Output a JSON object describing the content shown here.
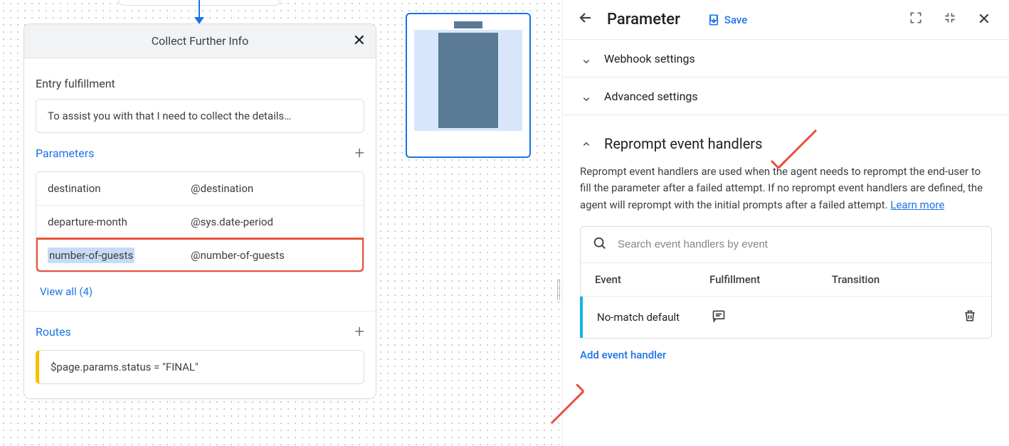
{
  "page_card": {
    "title": "Collect Further Info",
    "entry_label": "Entry fulfillment",
    "entry_text": "To assist you with that I need to collect the details…",
    "params_label": "Parameters",
    "params": [
      {
        "name": "destination",
        "entity": "@destination"
      },
      {
        "name": "departure-month",
        "entity": "@sys.date-period"
      },
      {
        "name": "number-of-guests",
        "entity": "@number-of-guests"
      }
    ],
    "view_all": "View all (4)",
    "routes_label": "Routes",
    "route_condition": "$page.params.status = \"FINAL\""
  },
  "panel": {
    "title": "Parameter",
    "save": "Save",
    "sections": {
      "webhook": "Webhook settings",
      "advanced": "Advanced settings",
      "reprompt": "Reprompt event handlers"
    },
    "reprompt_desc": "Reprompt event handlers are used when the agent needs to reprompt the end-user to fill the parameter after a failed attempt. If no reprompt event handlers are defined, the agent will reprompt with the initial prompts after a failed attempt. ",
    "learn_more": "Learn more",
    "search_placeholder": "Search event handlers by event",
    "table": {
      "event": "Event",
      "fulfillment": "Fulfillment",
      "transition": "Transition"
    },
    "row_event": "No-match default",
    "add_handler": "Add event handler"
  }
}
